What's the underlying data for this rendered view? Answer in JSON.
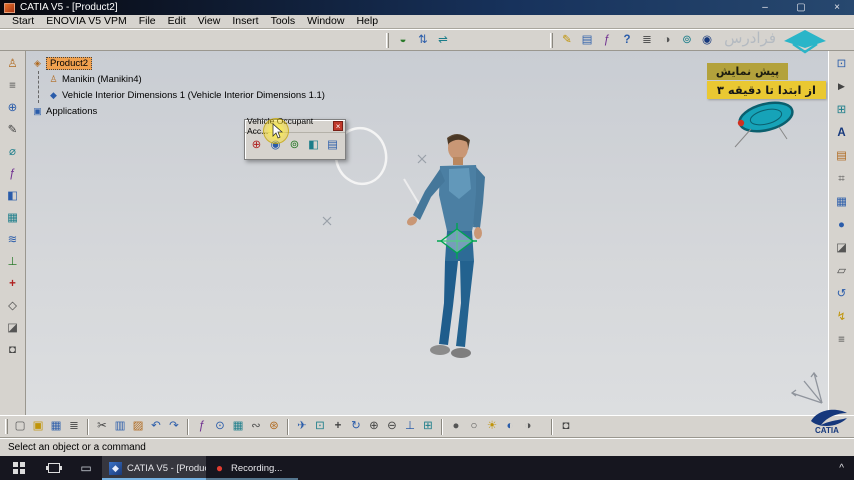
{
  "titlebar": {
    "title": "CATIA V5 - [Product2]",
    "minimize": "–",
    "restore": "▢",
    "close": "×"
  },
  "menubar": {
    "items": [
      "Start",
      "ENOVIA V5 VPM",
      "File",
      "Edit",
      "View",
      "Insert",
      "Tools",
      "Window",
      "Help"
    ]
  },
  "top_toolbar": {
    "group_a": [
      {
        "name": "apply-material-icon",
        "glyph": "◒"
      },
      {
        "name": "swap-view-icon",
        "glyph": "⇅"
      },
      {
        "name": "measure-icon",
        "glyph": "⇌"
      }
    ],
    "group_b": [
      {
        "name": "pencil-tool-icon",
        "glyph": "✎"
      },
      {
        "name": "catalog-icon",
        "glyph": "▤"
      },
      {
        "name": "formula-icon",
        "glyph": "ƒ"
      },
      {
        "name": "help-icon",
        "glyph": "?"
      },
      {
        "name": "layers-icon",
        "glyph": "≣"
      },
      {
        "name": "contrast-icon",
        "glyph": "◑"
      },
      {
        "name": "world-icon",
        "glyph": "⊚"
      },
      {
        "name": "target-icon",
        "glyph": "◉"
      }
    ]
  },
  "watermark": {
    "text": "فرادرس"
  },
  "overlay_banner": {
    "line1": "پیش نمایش",
    "line2": "از ابتدا تا دقیقه ۳"
  },
  "tree": {
    "root": {
      "label": "Product2",
      "glyph": "◈"
    },
    "items": [
      {
        "label": "Manikin (Manikin4)",
        "glyph": "♙"
      },
      {
        "label": "Vehicle Interior Dimensions 1 (Vehicle Interior Dimensions 1.1)",
        "glyph": "◆"
      },
      {
        "label": "Applications",
        "glyph": "▣"
      }
    ]
  },
  "floating_toolbar": {
    "title": "Vehicle Occupant Acc...",
    "close": "×",
    "icons": [
      {
        "name": "hpoint-design-icon",
        "glyph": "⊕"
      },
      {
        "name": "vision-icon",
        "glyph": "◉"
      },
      {
        "name": "eyellipse-icon",
        "glyph": "⊚"
      },
      {
        "name": "mirror-vision-icon",
        "glyph": "◧"
      },
      {
        "name": "report-icon",
        "glyph": "▤"
      }
    ]
  },
  "left_toolbar": {
    "icons": [
      {
        "name": "manikin-icon",
        "glyph": "♙"
      },
      {
        "name": "structure-tree-icon",
        "glyph": "≡"
      },
      {
        "name": "globe-icon",
        "glyph": "⊕"
      },
      {
        "name": "sketch-pencil-icon",
        "glyph": "✎"
      },
      {
        "name": "diameter-icon",
        "glyph": "⌀"
      },
      {
        "name": "knowledge-formula-icon",
        "glyph": "ƒ"
      },
      {
        "name": "fill-color-icon",
        "glyph": "◧"
      },
      {
        "name": "grid-icon",
        "glyph": "▦"
      },
      {
        "name": "waves-icon",
        "glyph": "≋"
      },
      {
        "name": "constraint-icon",
        "glyph": "⊥"
      },
      {
        "name": "axis-cross-icon",
        "glyph": "+"
      },
      {
        "name": "plane-diamond-icon",
        "glyph": "◇"
      },
      {
        "name": "section-icon",
        "glyph": "◪"
      },
      {
        "name": "render-camera-icon",
        "glyph": "◘"
      }
    ]
  },
  "right_toolbar": {
    "icons": [
      {
        "name": "fit-view-icon",
        "glyph": "⊡"
      },
      {
        "name": "pointer-icon",
        "glyph": "►"
      },
      {
        "name": "window-zoom-icon",
        "glyph": "⊞"
      },
      {
        "name": "annotation-text-icon",
        "glyph": "A"
      },
      {
        "name": "clipboard-icon",
        "glyph": "▤"
      },
      {
        "name": "measure-grid-icon",
        "glyph": "⌗"
      },
      {
        "name": "mesh-icon",
        "glyph": "▦"
      },
      {
        "name": "sphere-icon",
        "glyph": "●"
      },
      {
        "name": "section-cut-icon",
        "glyph": "◪"
      },
      {
        "name": "plane-icon",
        "glyph": "▱"
      },
      {
        "name": "rotate-ccw-icon",
        "glyph": "↺"
      },
      {
        "name": "bolt-icon",
        "glyph": "↯"
      },
      {
        "name": "list-icon",
        "glyph": "≡"
      }
    ]
  },
  "bottom_toolbar": {
    "file": [
      {
        "name": "new-file-icon",
        "glyph": "▢"
      },
      {
        "name": "open-folder-icon",
        "glyph": "▣"
      },
      {
        "name": "save-icon",
        "glyph": "▦"
      },
      {
        "name": "print-icon",
        "glyph": "≣"
      }
    ],
    "edit": [
      {
        "name": "cut-icon",
        "glyph": "✂"
      },
      {
        "name": "copy-icon",
        "glyph": "▥"
      },
      {
        "name": "paste-icon",
        "glyph": "▨"
      },
      {
        "name": "undo-icon",
        "glyph": "↶"
      },
      {
        "name": "redo-icon",
        "glyph": "↷"
      }
    ],
    "tools": [
      {
        "name": "formula-icon",
        "glyph": "ƒ"
      },
      {
        "name": "comment-icon",
        "glyph": "⊙"
      },
      {
        "name": "table-icon",
        "glyph": "▦"
      },
      {
        "name": "link-icon",
        "glyph": "∾"
      },
      {
        "name": "parameters-icon",
        "glyph": "⊛"
      }
    ],
    "view": [
      {
        "name": "fly-mode-icon",
        "glyph": "✈"
      },
      {
        "name": "fit-all-icon",
        "glyph": "⊡"
      },
      {
        "name": "pan-icon",
        "glyph": "+"
      },
      {
        "name": "rotate-view-icon",
        "glyph": "↻"
      },
      {
        "name": "zoom-in-icon",
        "glyph": "⊕"
      },
      {
        "name": "zoom-out-icon",
        "glyph": "⊖"
      },
      {
        "name": "normal-view-icon",
        "glyph": "⊥"
      },
      {
        "name": "multi-view-icon",
        "glyph": "⊞"
      }
    ],
    "render": [
      {
        "name": "shaded-icon",
        "glyph": "●"
      },
      {
        "name": "wireframe-icon",
        "glyph": "○"
      },
      {
        "name": "lighting-icon",
        "glyph": "☀"
      },
      {
        "name": "hide-show-icon",
        "glyph": "◐"
      },
      {
        "name": "swap-visible-icon",
        "glyph": "◑"
      }
    ],
    "capture": [
      {
        "name": "camera-icon",
        "glyph": "◘"
      }
    ]
  },
  "statusbar": {
    "message": "Select an object or a command"
  },
  "taskbar": {
    "chevron": "^",
    "tasks": [
      {
        "label": "CATIA V5 - [Produc...",
        "icon_glyph": "◆"
      },
      {
        "label": "Recording...",
        "icon_glyph": "●"
      }
    ]
  },
  "logo": {
    "catia": "CATIA"
  }
}
